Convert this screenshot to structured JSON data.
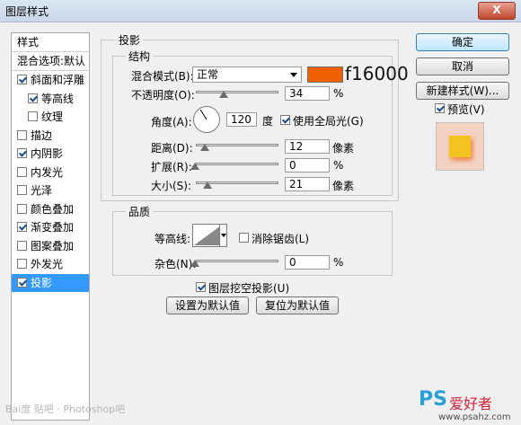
{
  "window": {
    "title": "图层样式",
    "close_glyph": "X"
  },
  "sidebar": {
    "header1": "样式",
    "header2": "混合选项:默认",
    "items": [
      {
        "label": "斜面和浮雕",
        "checked": true
      },
      {
        "label": "等高线",
        "checked": true,
        "sub": true
      },
      {
        "label": "纹理",
        "checked": false,
        "sub": true
      },
      {
        "label": "描边",
        "checked": false
      },
      {
        "label": "内阴影",
        "checked": true
      },
      {
        "label": "内发光",
        "checked": false
      },
      {
        "label": "光泽",
        "checked": false
      },
      {
        "label": "颜色叠加",
        "checked": false
      },
      {
        "label": "渐变叠加",
        "checked": true
      },
      {
        "label": "图案叠加",
        "checked": false
      },
      {
        "label": "外发光",
        "checked": false
      },
      {
        "label": "投影",
        "checked": true,
        "active": true
      }
    ]
  },
  "panel": {
    "title": "投影",
    "structure": {
      "title": "结构",
      "blend_label": "混合模式(B):",
      "blend_value": "正常",
      "swatch_color": "#f16000",
      "color_hex_text": "f16000",
      "opacity_label": "不透明度(O):",
      "opacity_value": "34",
      "percent": "%",
      "angle_label": "角度(A):",
      "angle_value": "120",
      "angle_unit": "度",
      "global_light_label": "使用全局光(G)",
      "global_light_checked": true,
      "distance_label": "距离(D):",
      "distance_value": "12",
      "pixels": "像素",
      "spread_label": "扩展(R):",
      "spread_value": "0",
      "size_label": "大小(S):",
      "size_value": "21"
    },
    "quality": {
      "title": "品质",
      "contour_label": "等高线:",
      "antialias_label": "消除锯齿(L)",
      "antialias_checked": false,
      "noise_label": "杂色(N):",
      "noise_value": "0",
      "percent": "%"
    },
    "knockout_label": "图层挖空投影(U)",
    "knockout_checked": true,
    "make_default": "设置为默认值",
    "reset_default": "复位为默认值"
  },
  "buttons": {
    "ok": "确定",
    "cancel": "取消",
    "new_style": "新建样式(W)...",
    "preview": "预览(V)",
    "preview_checked": true
  },
  "watermark": {
    "left": "Bai度 贴吧 · Photoshop吧",
    "brand": "PS",
    "brand_cn": "爱好者",
    "site": "www.psahz.com"
  }
}
